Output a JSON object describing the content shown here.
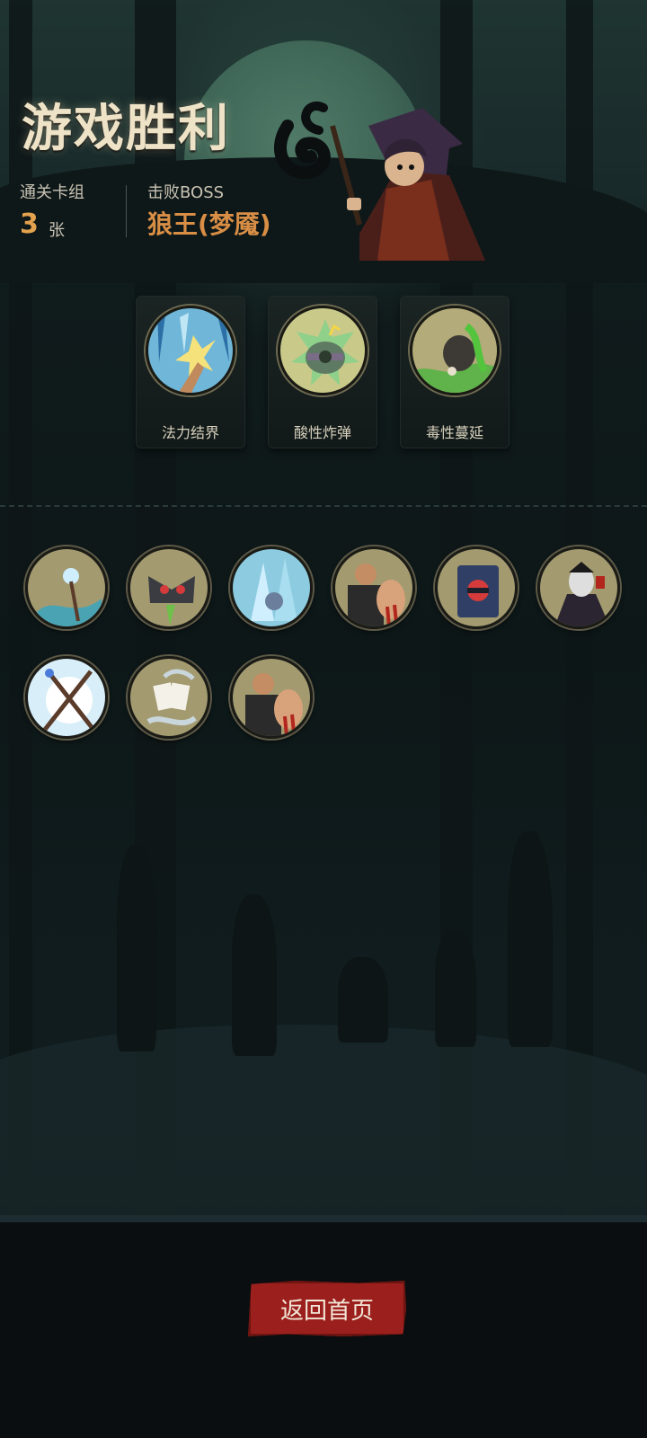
{
  "header": {
    "title": "游戏胜利",
    "cards_label": "通关卡组",
    "cards_count": "3",
    "cards_unit": "张",
    "boss_label": "击败BOSS",
    "boss_name": "狼王(梦魇)"
  },
  "relics": [
    {
      "name": "法力结界",
      "icon": "mana-barrier-icon"
    },
    {
      "name": "酸性炸弹",
      "icon": "acid-bomb-icon"
    },
    {
      "name": "毒性蔓延",
      "icon": "poison-spread-icon"
    }
  ],
  "cards": [
    {
      "icon": "water-wave-card-icon"
    },
    {
      "icon": "skull-bat-card-icon"
    },
    {
      "icon": "ice-crystal-card-icon"
    },
    {
      "icon": "brute-bleed-card-icon"
    },
    {
      "icon": "spell-book-card-icon"
    },
    {
      "icon": "vampire-card-icon"
    },
    {
      "icon": "crossed-staffs-card-icon"
    },
    {
      "icon": "ghost-cards-card-icon"
    },
    {
      "icon": "brute-bleed-card-icon"
    }
  ],
  "actions": {
    "return_home": "返回首页"
  },
  "colors": {
    "accent_orange": "#e3a24e",
    "boss_orange": "#d88e45",
    "button_red": "#9b1f1c"
  }
}
